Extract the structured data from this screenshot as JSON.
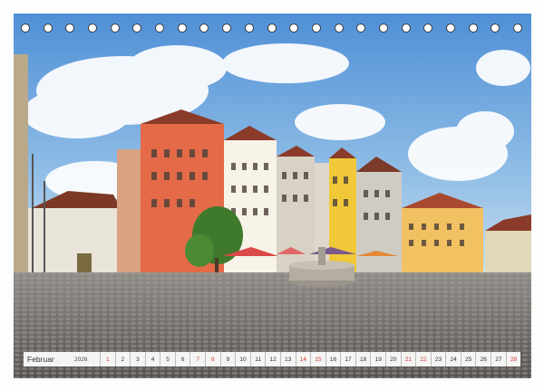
{
  "calendar": {
    "month": "Februar",
    "year": "2026",
    "days": [
      {
        "n": "1",
        "weekend": true
      },
      {
        "n": "2",
        "weekend": false
      },
      {
        "n": "3",
        "weekend": false
      },
      {
        "n": "4",
        "weekend": false
      },
      {
        "n": "5",
        "weekend": false
      },
      {
        "n": "6",
        "weekend": false
      },
      {
        "n": "7",
        "weekend": true
      },
      {
        "n": "8",
        "weekend": true
      },
      {
        "n": "9",
        "weekend": false
      },
      {
        "n": "10",
        "weekend": false
      },
      {
        "n": "11",
        "weekend": false
      },
      {
        "n": "12",
        "weekend": false
      },
      {
        "n": "13",
        "weekend": false
      },
      {
        "n": "14",
        "weekend": true
      },
      {
        "n": "15",
        "weekend": true
      },
      {
        "n": "16",
        "weekend": false
      },
      {
        "n": "17",
        "weekend": false
      },
      {
        "n": "18",
        "weekend": false
      },
      {
        "n": "19",
        "weekend": false
      },
      {
        "n": "20",
        "weekend": false
      },
      {
        "n": "21",
        "weekend": true
      },
      {
        "n": "22",
        "weekend": true
      },
      {
        "n": "23",
        "weekend": false
      },
      {
        "n": "24",
        "weekend": false
      },
      {
        "n": "25",
        "weekend": false
      },
      {
        "n": "26",
        "weekend": false
      },
      {
        "n": "27",
        "weekend": false
      },
      {
        "n": "28",
        "weekend": true
      }
    ],
    "weekend_color": "#d03a2a"
  },
  "binding": {
    "ring_count": 23
  },
  "photo": {
    "subject": "town-square-with-colorful-houses-and-fountain"
  }
}
